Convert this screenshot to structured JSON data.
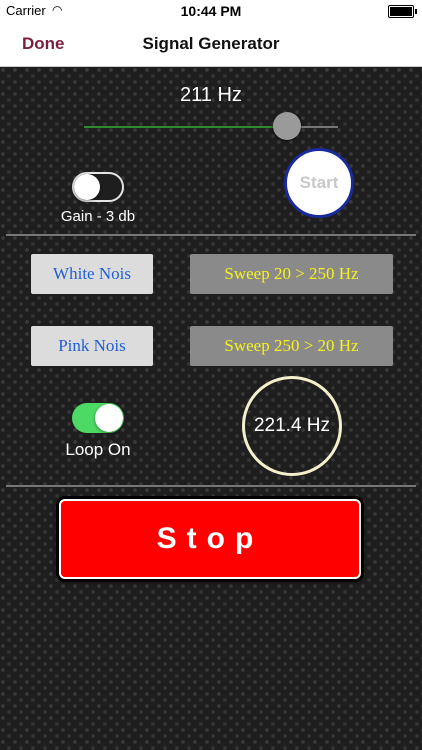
{
  "status_bar": {
    "carrier": "Carrier",
    "wifi_icon": "wifi-icon",
    "time": "10:44 PM",
    "battery_level": 1.0
  },
  "nav": {
    "done_label": "Done",
    "title": "Signal Generator"
  },
  "generator": {
    "frequency_label": "211 Hz",
    "slider_value": 0.8,
    "start_label": "Start",
    "gain_label": "Gain - 3 db",
    "gain_on": false
  },
  "buttons": {
    "white_noise": "White Nois",
    "pink_noise": "Pink Nois",
    "sweep_up": "Sweep 20 > 250 Hz",
    "sweep_down": "Sweep 250 > 20 Hz"
  },
  "loop": {
    "label": "Loop On",
    "on": true
  },
  "current_frequency": "221.4 Hz",
  "stop_label": "Stop",
  "colors": {
    "accent": "#7b1f3f",
    "slider_fill": "#2f8a2f",
    "toggle_on": "#4cd964",
    "stop": "#ff0000",
    "sweep_text": "#f7f318",
    "noise_text": "#1f5fd6"
  }
}
